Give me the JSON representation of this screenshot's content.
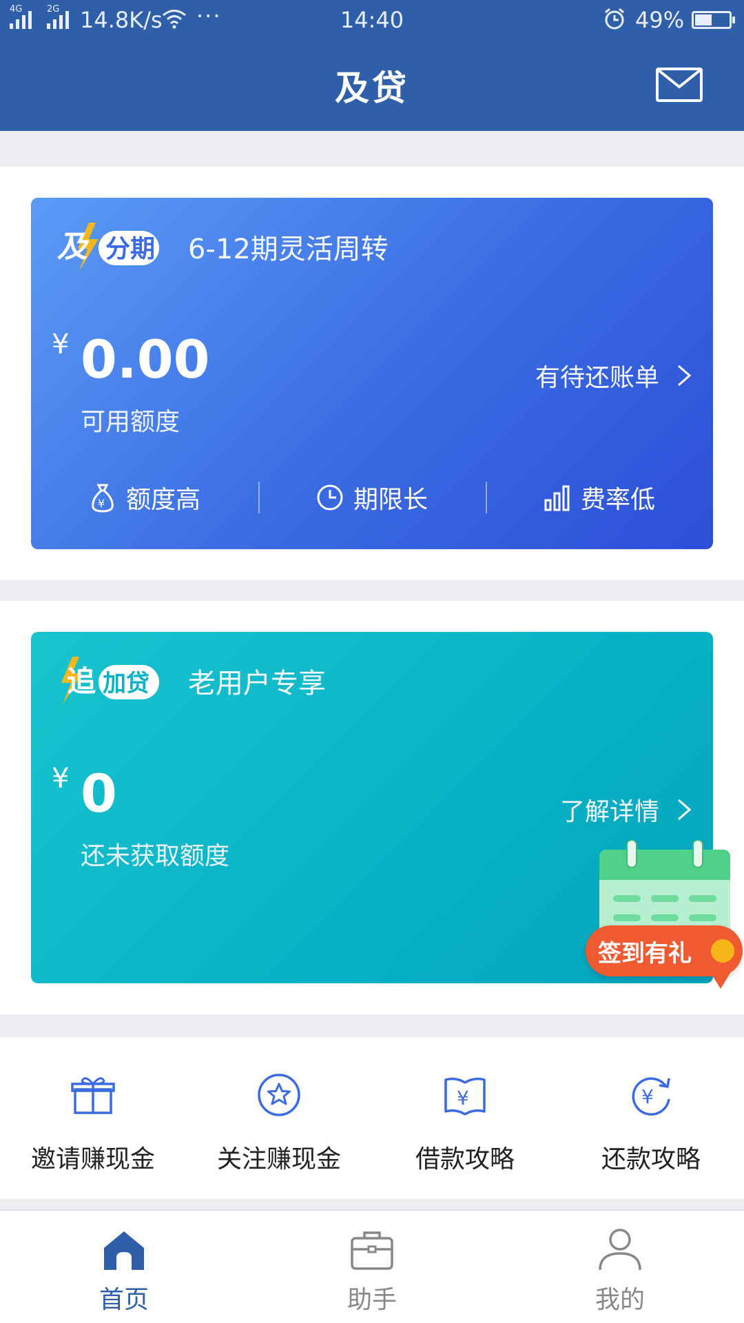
{
  "status_bar": {
    "net1": "4G",
    "net2": "2G",
    "speed": "14.8K/s",
    "dots": "···",
    "time": "14:40",
    "battery": "49%"
  },
  "header": {
    "title": "及贷",
    "mail_icon": "envelope-icon"
  },
  "card_installment": {
    "logo_text": "及分期",
    "subtitle": "6-12期灵活周转",
    "currency": "¥",
    "amount": "0.00",
    "amount_label": "可用额度",
    "link_label": "有待还账单",
    "features": [
      {
        "label": "额度高",
        "icon": "money-bag-icon"
      },
      {
        "label": "期限长",
        "icon": "clock-icon"
      },
      {
        "label": "费率低",
        "icon": "bar-chart-icon"
      }
    ],
    "colors": {
      "from": "#5b9bf6",
      "to": "#2c4fd8"
    }
  },
  "card_topup": {
    "logo_text": "追加贷",
    "subtitle": "老用户专享",
    "currency": "¥",
    "amount": "0",
    "amount_label": "还未获取额度",
    "link_label": "了解详情",
    "colors": {
      "from": "#19c3cf",
      "to": "#03a3bc"
    }
  },
  "checkin": {
    "label": "签到有礼",
    "icon": "calendar-icon"
  },
  "quick_links": [
    {
      "label": "邀请赚现金",
      "icon": "gift-icon"
    },
    {
      "label": "关注赚现金",
      "icon": "star-icon"
    },
    {
      "label": "借款攻略",
      "icon": "book-yuan-icon"
    },
    {
      "label": "还款攻略",
      "icon": "yuan-refresh-icon"
    }
  ],
  "tab_bar": [
    {
      "label": "首页",
      "icon": "home-icon",
      "active": true
    },
    {
      "label": "助手",
      "icon": "briefcase-icon",
      "active": false
    },
    {
      "label": "我的",
      "icon": "user-icon",
      "active": false
    }
  ],
  "accent": "#2f5fa8"
}
